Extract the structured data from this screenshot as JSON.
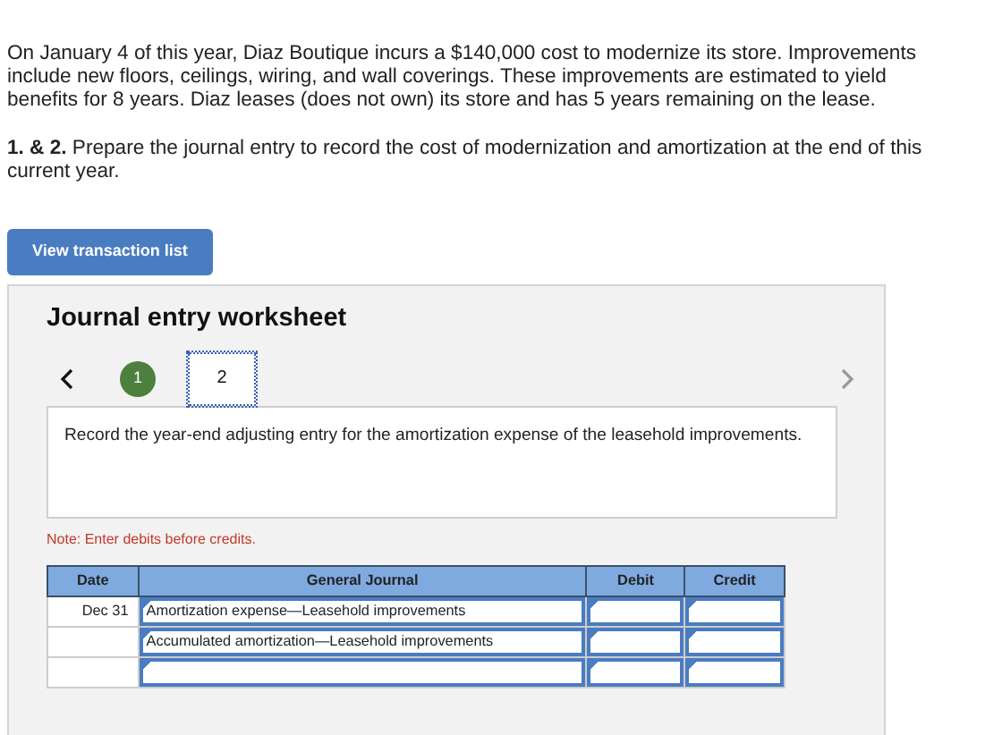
{
  "problem": {
    "text": "On January 4 of this year, Diaz Boutique incurs a $140,000 cost to modernize its store. Improvements include new floors, ceilings, wiring, and wall coverings. These improvements are estimated to yield benefits for 8 years. Diaz leases (does not own) its store and has 5 years remaining on the lease.",
    "question": "**1. & 2.** Prepare the journal entry to record the cost of modernization and amortization at the end of this current year."
  },
  "transaction_button": "View transaction list",
  "worksheet": {
    "title": "Journal entry worksheet",
    "steps": [
      {
        "label": "1",
        "completed": true,
        "selected": false
      },
      {
        "label": "2",
        "completed": false,
        "selected": true
      }
    ],
    "instruction": "Record the year-end adjusting entry for the amortization expense of the leasehold improvements.",
    "note": "Note: Enter debits before credits.",
    "table": {
      "columns": [
        "Date",
        "General Journal",
        "Debit",
        "Credit"
      ],
      "rows": [
        {
          "date": "Dec 31",
          "account": "Amortization expense—Leasehold improvements"
        },
        {
          "account": "Accumulated amortization—Leasehold improvements"
        },
        {}
      ]
    }
  }
}
